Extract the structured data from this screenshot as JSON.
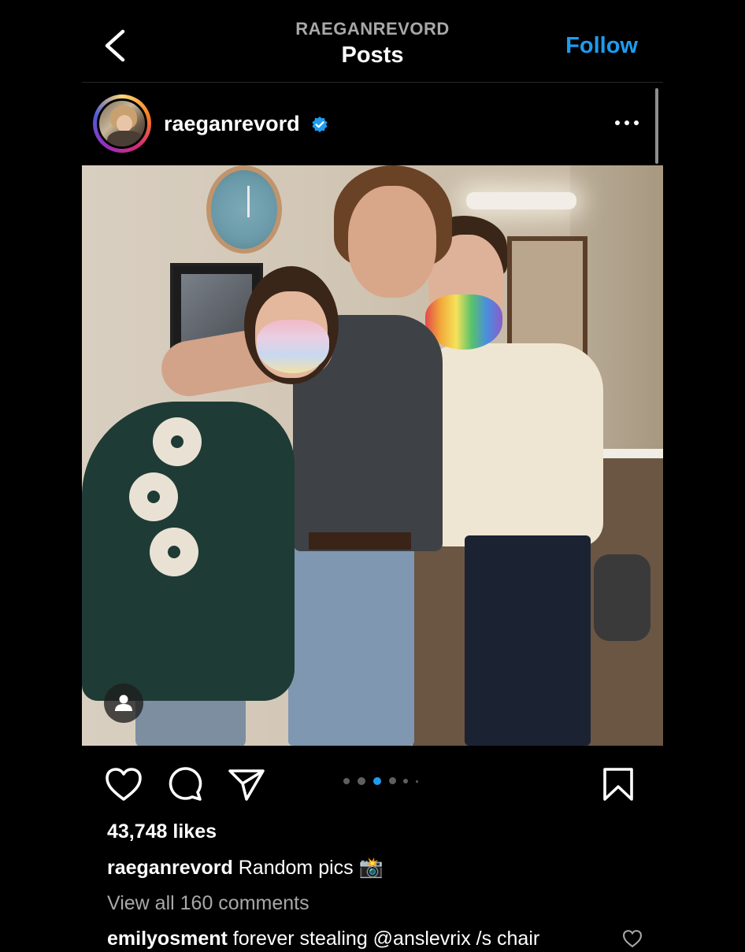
{
  "header": {
    "account": "RAEGANREVORD",
    "title": "Posts",
    "follow_label": "Follow"
  },
  "post": {
    "username": "raeganrevord",
    "verified": true,
    "likes": "43,748 likes",
    "caption_user": "raeganrevord",
    "caption_text": "Random pics 📸",
    "view_comments": "View all 160 comments",
    "comment_user": "emilyosment",
    "comment_text": "forever stealing @anslevrix /s chair",
    "carousel": {
      "count": 6,
      "active_index": 2
    }
  },
  "colors": {
    "background": "#000000",
    "accent": "#1e9cf0",
    "muted_text": "#a8a8a8"
  },
  "icons": [
    "back-chevron-icon",
    "verified-badge-icon",
    "more-options-icon",
    "user-tag-icon",
    "heart-icon",
    "comment-icon",
    "share-icon",
    "bookmark-icon"
  ]
}
